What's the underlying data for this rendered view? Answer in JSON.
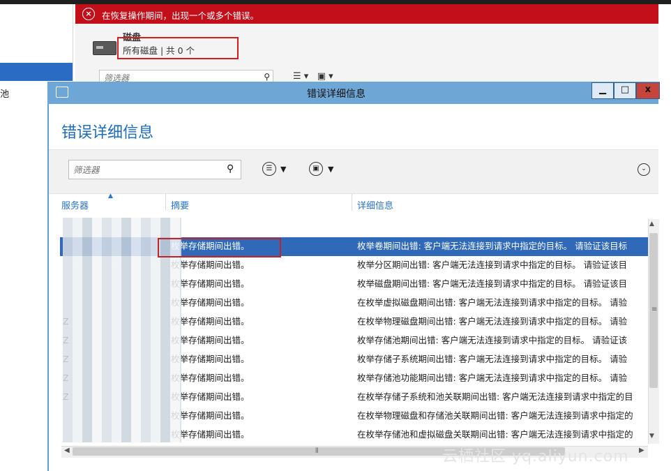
{
  "background": {
    "left_pane_char": "池",
    "error_banner": "在恢复操作期间，出现一个或多个错误。",
    "disk_title": "磁盘",
    "disk_subtitle": "所有磁盘 | 共 0 个",
    "filter_placeholder": "筛选器"
  },
  "dialog": {
    "title": "错误详细信息",
    "heading": "错误详细信息",
    "filter_placeholder": "筛选器",
    "buttons": {
      "minimize": "▁",
      "maximize": "□",
      "close": "x"
    },
    "columns": [
      "服务器",
      "摘要",
      "详细信息"
    ],
    "rows": [
      {
        "server": "",
        "summary": "枚举存储期间出错。",
        "detail": "枚举卷期间出错: 客户端无法连接到请求中指定的目标。 请验证该目标",
        "selected": true
      },
      {
        "server": "",
        "summary": "枚举存储期间出错。",
        "detail": "枚举分区期间出错: 客户端无法连接到请求中指定的目标。 请验证该目",
        "selected": false
      },
      {
        "server": "",
        "summary": "枚举存储期间出错。",
        "detail": "枚举磁盘期间出错: 客户端无法连接到请求中指定的目标。 请验证该目",
        "selected": false
      },
      {
        "server": "",
        "summary": "枚举存储期间出错。",
        "detail": "在枚举虚拟磁盘期间出错: 客户端无法连接到请求中指定的目标。 请验",
        "selected": false
      },
      {
        "server": "Z",
        "summary": "枚举存储期间出错。",
        "detail": "在枚举物理磁盘期间出错: 客户端无法连接到请求中指定的目标。 请验",
        "selected": false
      },
      {
        "server": "Z",
        "summary": "枚举存储期间出错。",
        "detail": "枚举存储池期间出错: 客户端无法连接到请求中指定的目标。 请验证该",
        "selected": false
      },
      {
        "server": "Z",
        "summary": "枚举存储期间出错。",
        "detail": "枚举存储子系统期间出错: 客户端无法连接到请求中指定的目标。 请验",
        "selected": false
      },
      {
        "server": "Z",
        "summary": "枚举存储期间出错。",
        "detail": "枚举存储池功能期间出错: 客户端无法连接到请求中指定的目标。 请验",
        "selected": false
      },
      {
        "server": "Z",
        "summary": "枚举存储期间出错。",
        "detail": "在枚举存储子系统和池关联期间出错: 客户端无法连接到请求中指定的目",
        "selected": false
      },
      {
        "server": "",
        "summary": "枚举存储期间出错。",
        "detail": "在枚举物理磁盘和存储池关联期间出错: 客户端无法连接到请求中指定的",
        "selected": false
      },
      {
        "server": "",
        "summary": "枚举存储期间出错。",
        "detail": "在枚举存储池和虚拟磁盘关联期间出错: 客户端无法连接到请求中指定的",
        "selected": false
      }
    ]
  },
  "watermark": "云栖社区 yq.aliyun.com",
  "colors": {
    "accent": "#1e6bb8",
    "error": "#c30f1a",
    "selection": "#2f69b8",
    "titlebar": "#6ea7d6"
  }
}
